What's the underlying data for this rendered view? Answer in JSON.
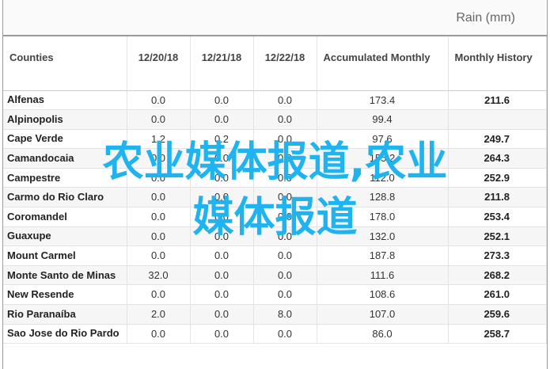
{
  "unit_label": "Rain (mm)",
  "headers": {
    "county": "Counties",
    "d1": "12/20/18",
    "d2": "12/21/18",
    "d3": "12/22/18",
    "acc": "Accumulated Monthly",
    "hist": "Monthly History"
  },
  "rows": [
    {
      "county": "Alfenas",
      "d1": "0.0",
      "d2": "0.0",
      "d3": "0.0",
      "acc": "173.4",
      "hist": "211.6"
    },
    {
      "county": "Alpinopolis",
      "d1": "0.0",
      "d2": "0.0",
      "d3": "0.0",
      "acc": "99.4",
      "hist": ""
    },
    {
      "county": "Cape Verde",
      "d1": "1.2",
      "d2": "0.2",
      "d3": "0.0",
      "acc": "97.6",
      "hist": "249.7"
    },
    {
      "county": "Camandocaia",
      "d1": "0.0",
      "d2": "0.0",
      "d3": "0.0",
      "acc": "155.2",
      "hist": "264.3"
    },
    {
      "county": "Campestre",
      "d1": "0.0",
      "d2": "0.0",
      "d3": "0.0",
      "acc": "112.0",
      "hist": "252.9"
    },
    {
      "county": "Carmo do Rio Claro",
      "d1": "0.0",
      "d2": "0.0",
      "d3": "0.0",
      "acc": "128.8",
      "hist": "211.8"
    },
    {
      "county": "Coromandel",
      "d1": "0.0",
      "d2": "0.0",
      "d3": "0.0",
      "acc": "178.0",
      "hist": "253.4"
    },
    {
      "county": "Guaxupe",
      "d1": "0.0",
      "d2": "0.0",
      "d3": "0.0",
      "acc": "132.0",
      "hist": "252.1"
    },
    {
      "county": "Mount Carmel",
      "d1": "0.0",
      "d2": "0.0",
      "d3": "0.0",
      "acc": "187.8",
      "hist": "273.3"
    },
    {
      "county": "Monte Santo de Minas",
      "d1": "32.0",
      "d2": "0.0",
      "d3": "0.0",
      "acc": "111.6",
      "hist": "268.2"
    },
    {
      "county": "New Resende",
      "d1": "0.0",
      "d2": "0.0",
      "d3": "0.0",
      "acc": "108.6",
      "hist": "261.0"
    },
    {
      "county": "Rio Paranaíba",
      "d1": "2.0",
      "d2": "0.0",
      "d3": "8.0",
      "acc": "107.0",
      "hist": "259.6"
    },
    {
      "county": "Sao Jose do Rio Pardo",
      "d1": "0.0",
      "d2": "0.0",
      "d3": "0.0",
      "acc": "86.0",
      "hist": "258.7"
    }
  ],
  "watermark": "农业媒体报道,农业媒体报道"
}
